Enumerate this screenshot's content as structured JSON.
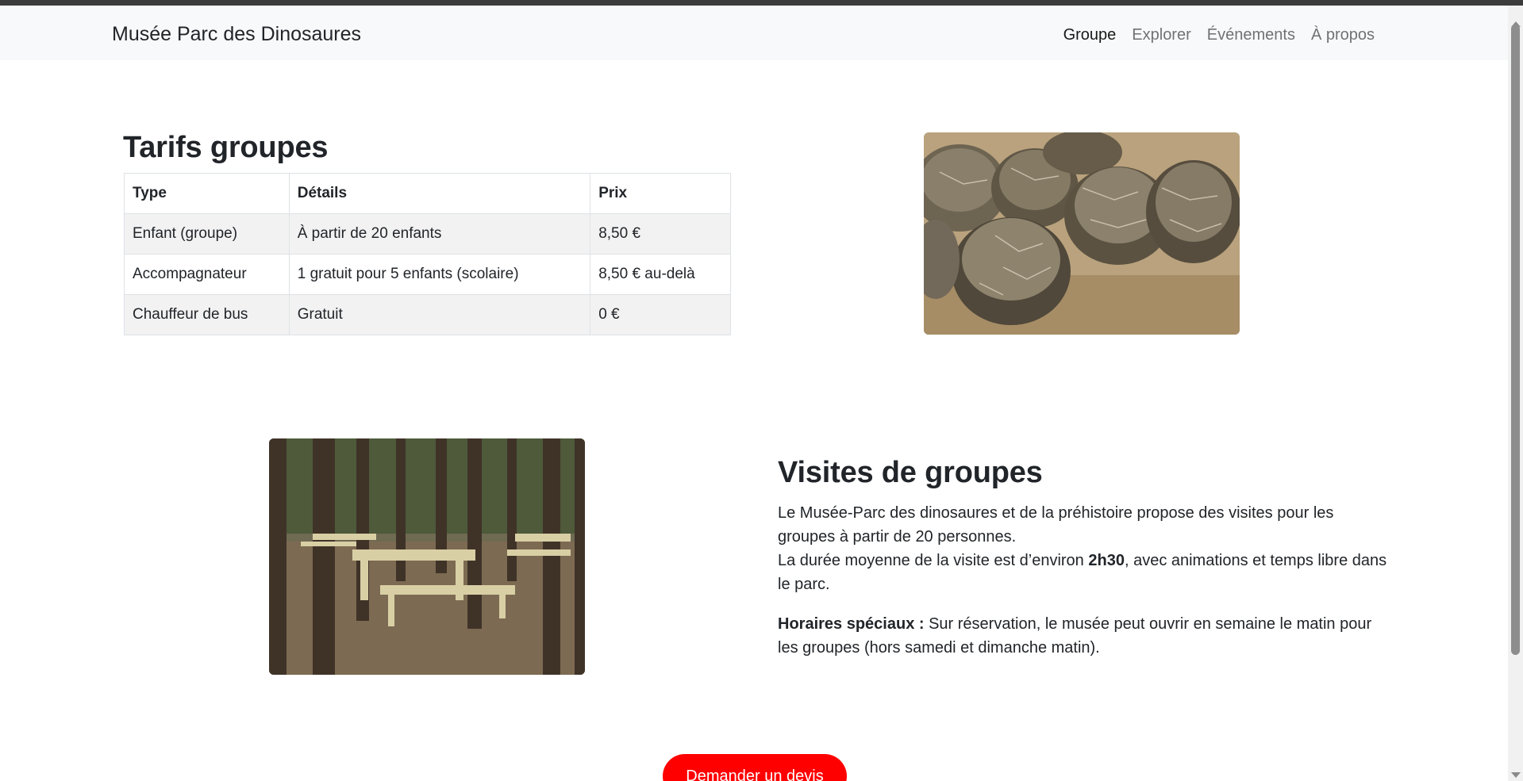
{
  "navbar": {
    "brand": "Musée Parc des Dinosaures",
    "links": [
      {
        "label": "Groupe"
      },
      {
        "label": "Explorer"
      },
      {
        "label": "Événements"
      },
      {
        "label": "À propos"
      }
    ]
  },
  "tarifs": {
    "title": "Tarifs groupes",
    "headers": [
      "Type",
      "Détails",
      "Prix"
    ],
    "rows": [
      [
        "Enfant (groupe)",
        "À partir de 20 enfants",
        "8,50 €"
      ],
      [
        "Accompagnateur",
        "1 gratuit pour 5 enfants (scolaire)",
        "8,50 € au-delà"
      ],
      [
        "Chauffeur de bus",
        "Gratuit",
        "0 €"
      ]
    ]
  },
  "images": {
    "eggs": "dinosaur-eggs-image",
    "tables": "picnic-tables-image"
  },
  "visites": {
    "title": "Visites de groupes",
    "p1_line1": "Le Musée-Parc des dinosaures et de la préhistoire propose des visites pour les groupes à partir de 20 personnes.",
    "p1_line2_before": "La durée moyenne de la visite est d’environ ",
    "p1_line2_bold": "2h30",
    "p1_line2_after": ", avec animations et temps libre dans le parc.",
    "p2_bold": "Horaires spéciaux :",
    "p2_text": " Sur réservation, le musée peut ouvrir en semaine le matin pour les groupes (hors samedi et dimanche matin)."
  },
  "cta": {
    "label": "Demander un devis"
  },
  "colors": {
    "accent": "#ff0000",
    "navbar_bg": "#f8f9fa",
    "stripe": "#f2f2f2"
  }
}
